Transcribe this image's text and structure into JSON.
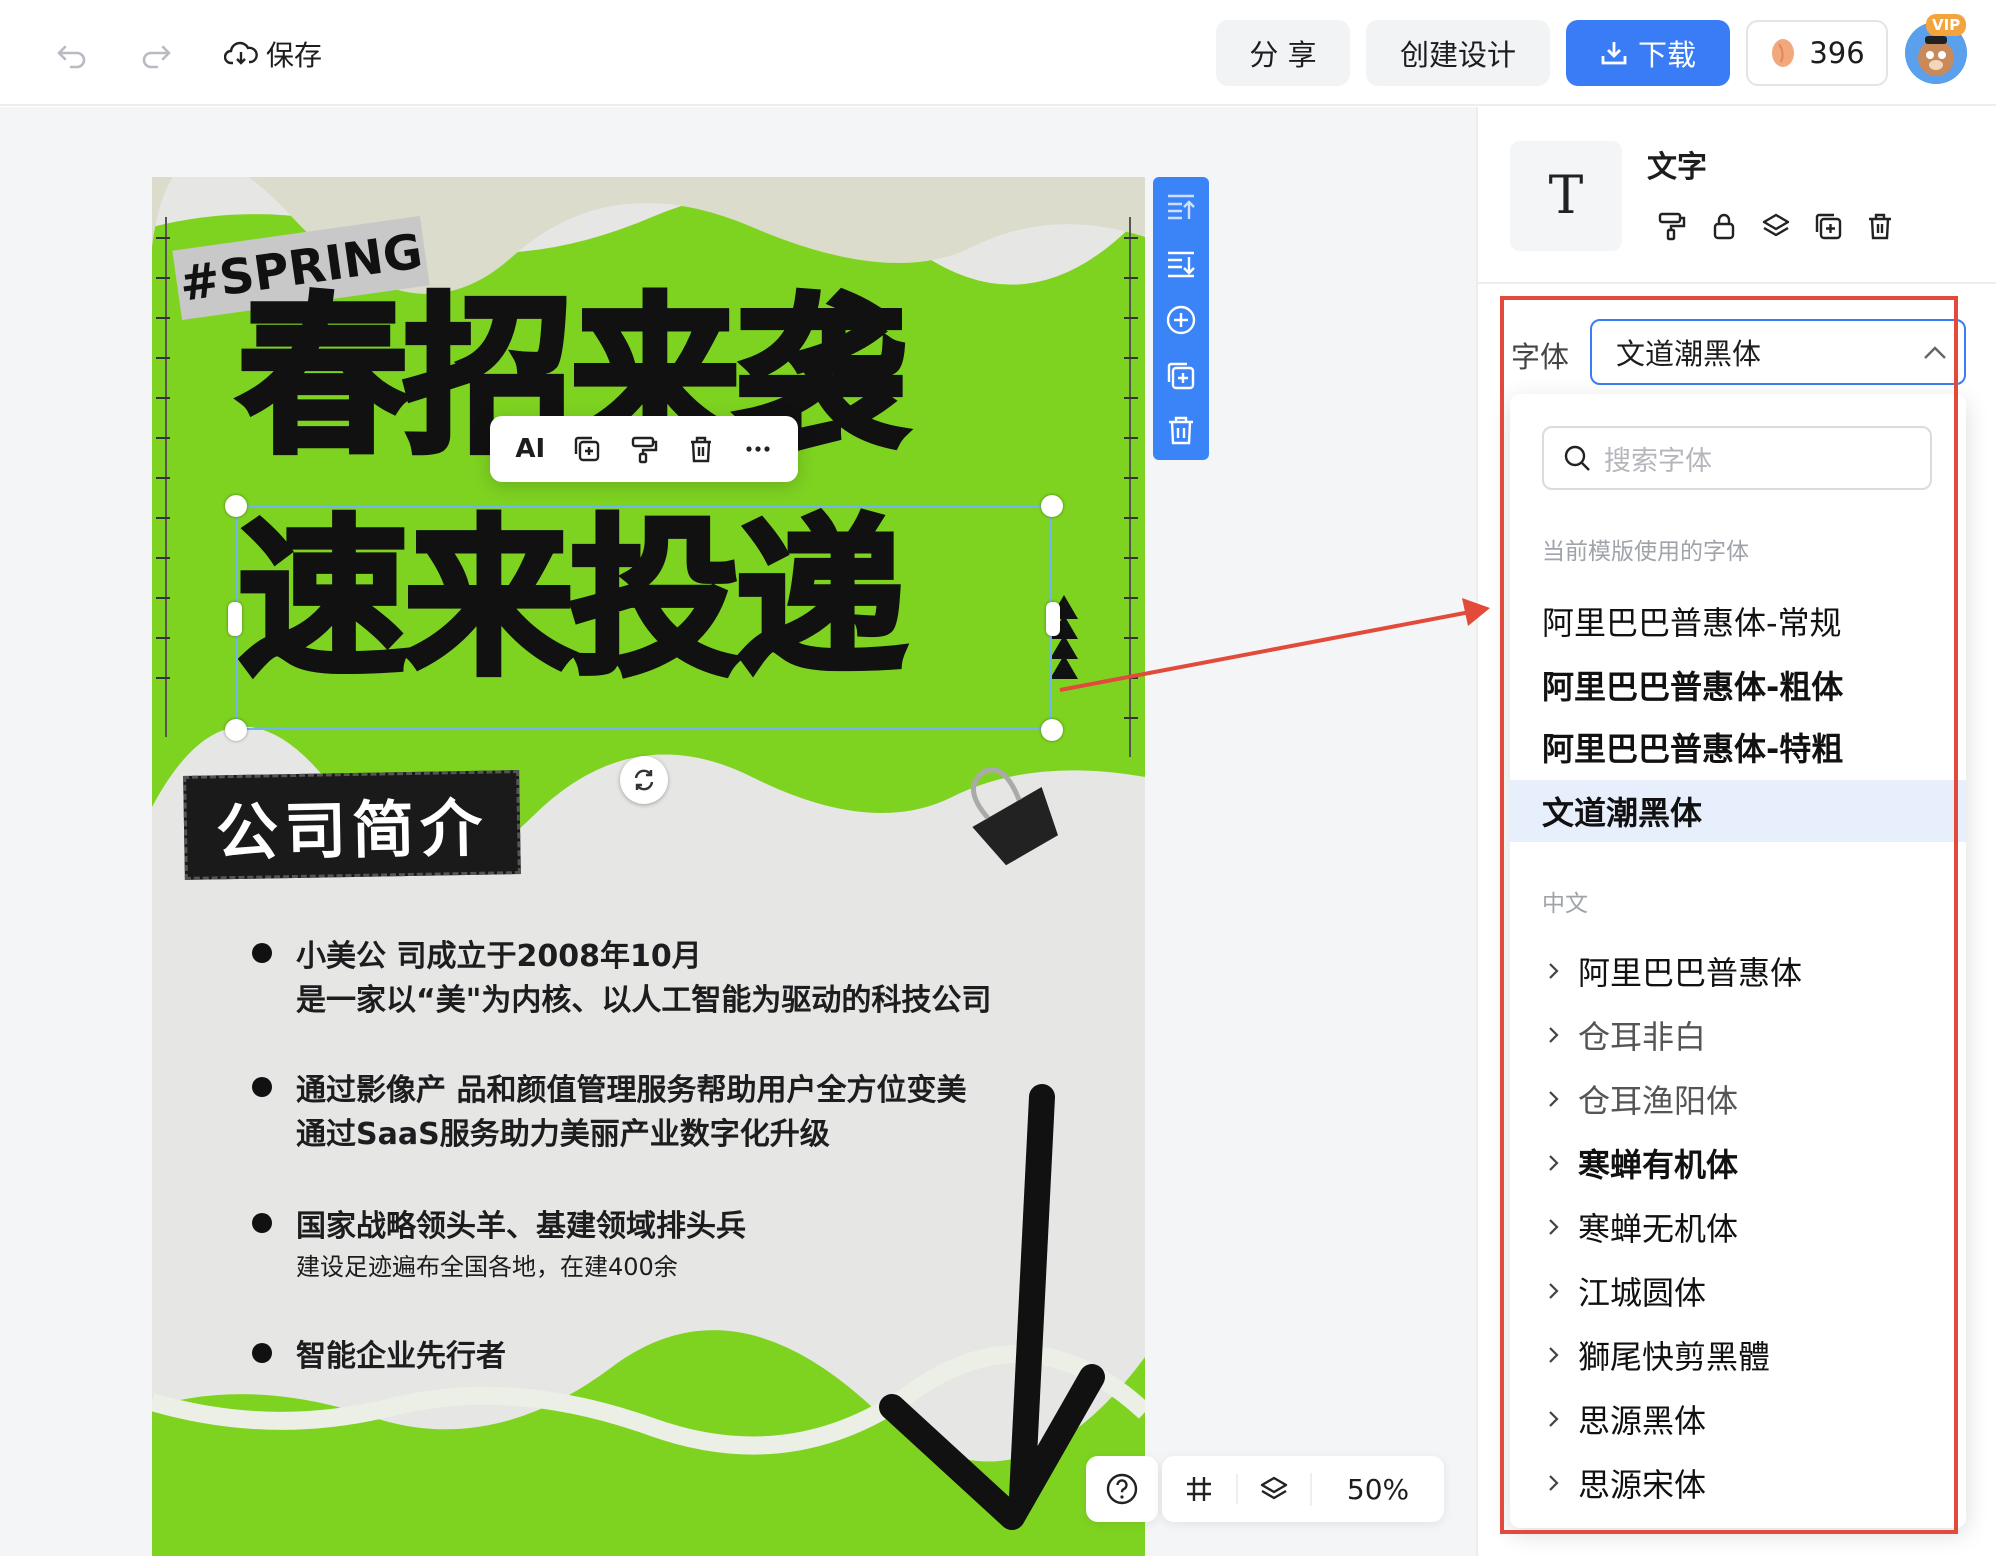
{
  "topbar": {
    "save_label": "保存",
    "share_label": "分 享",
    "create_label": "创建设计",
    "download_label": "下载",
    "credits": "396",
    "vip_badge": "VIP"
  },
  "poster": {
    "tag": "#SPRING",
    "headline_line1": "春招来袭",
    "headline_line2": "速来投递",
    "section_title": "公司简介",
    "bullets": [
      {
        "line1": "小美公 司成立于2008年10月",
        "line2": "是一家以“美\"为内核、以人工智能为驱动的科技公司"
      },
      {
        "line1": "通过影像产 品和颜值管理服务帮助用户全方位变美",
        "line2": "通过SaaS服务助力美丽产业数字化升级"
      },
      {
        "line1": "国家战略领头羊、基建领域排头兵",
        "line2": "建设足迹遍布全国各地，在建400余"
      },
      {
        "line1": "智能企业先行者",
        "line2": ""
      }
    ]
  },
  "floating_toolbar": {
    "ai_label": "AI"
  },
  "bottombar": {
    "zoom": "50%"
  },
  "panel": {
    "title": "文字",
    "font_label": "字体",
    "font_value": "文道潮黑体",
    "search_placeholder": "搜索字体",
    "section_current": "当前模版使用的字体",
    "current_fonts": [
      "阿里巴巴普惠体-常规",
      "阿里巴巴普惠体-粗体",
      "阿里巴巴普惠体-特粗",
      "文道潮黑体"
    ],
    "section_chinese": "中文",
    "chinese_fonts": [
      "阿里巴巴普惠体",
      "仓耳非白",
      "仓耳渔阳体",
      "寒蝉有机体",
      "寒蝉无机体",
      "江城圆体",
      "獅尾快剪黑體",
      "思源黑体",
      "思源宋体"
    ]
  },
  "colors": {
    "accent": "#3a7cf5",
    "poster_green": "#7ed321",
    "annotation_red": "#e24b3b"
  }
}
